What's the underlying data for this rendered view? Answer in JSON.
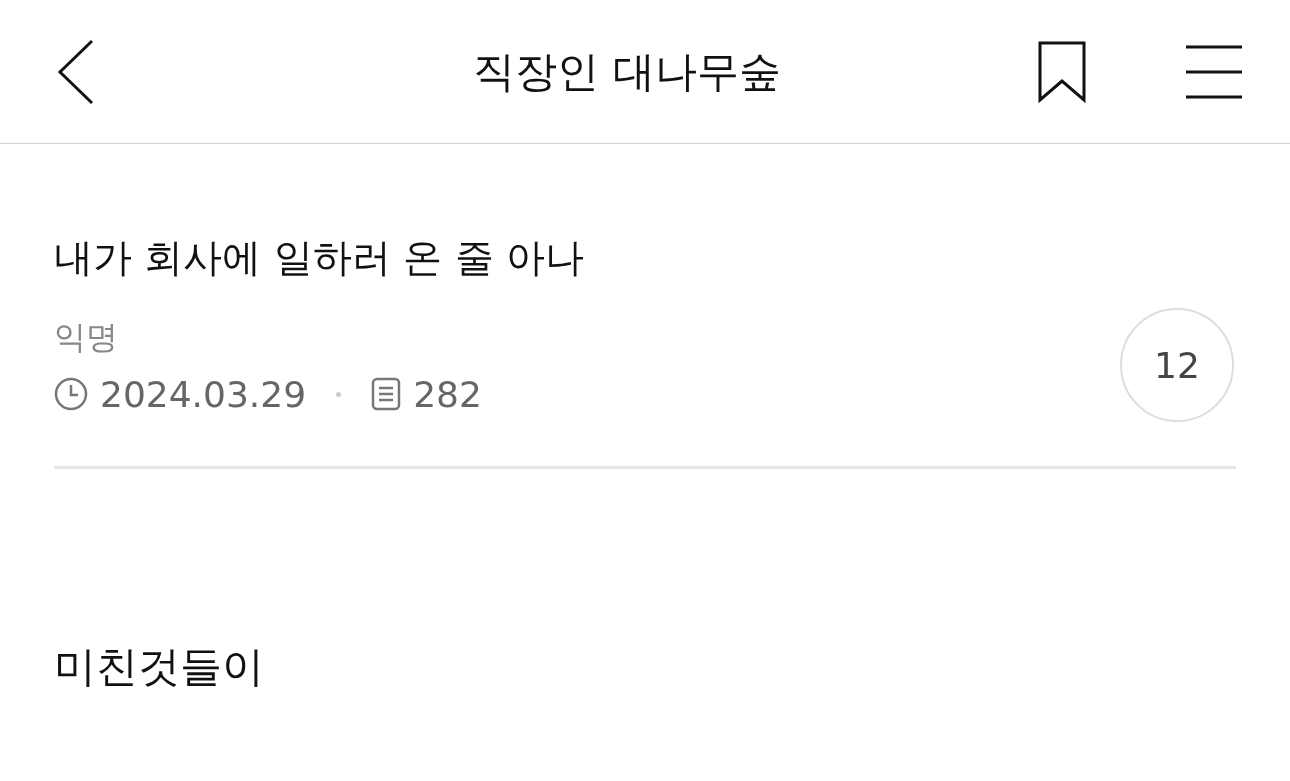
{
  "header": {
    "title": "직장인 대나무숲"
  },
  "post": {
    "title": "내가 회사에 일하러 온 줄 아나",
    "author": "익명",
    "date": "2024.03.29",
    "views": "282",
    "comment_count": "12"
  },
  "body": "미친것들이"
}
